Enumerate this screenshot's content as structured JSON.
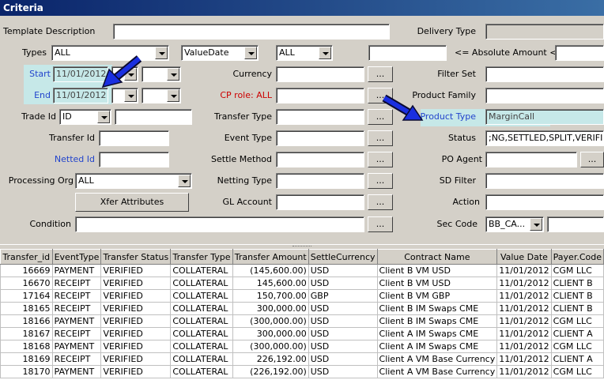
{
  "window": {
    "title": "Criteria"
  },
  "labels": {
    "template_description": "Template Description",
    "delivery_type": "Delivery Type",
    "types": "Types",
    "abs_amount": "<= Absolute Amount <=",
    "start": "Start",
    "end": "End",
    "currency": "Currency",
    "filter_set": "Filter Set",
    "cp_role": "CP role: ALL",
    "product_family": "Product Family",
    "trade_id": "Trade Id",
    "transfer_type": "Transfer Type",
    "product_type": "Product Type",
    "transfer_id": "Transfer Id",
    "event_type": "Event Type",
    "status": "Status",
    "netted_id": "Netted Id",
    "settle_method": "Settle Method",
    "po_agent": "PO Agent",
    "processing_org": "Processing Org",
    "netting_type": "Netting Type",
    "sd_filter": "SD Filter",
    "gl_account": "GL Account",
    "action": "Action",
    "condition": "Condition",
    "sec_code": "Sec Code"
  },
  "values": {
    "types": "ALL",
    "value_date": "ValueDate",
    "all2": "ALL",
    "start_date": "11/01/2012",
    "end_date": "11/01/2012",
    "trade_id": "ID",
    "processing_org": "ALL",
    "product_type": "MarginCall",
    "status": ";NG,SETTLED,SPLIT,VERIFIED",
    "sec_code": "BB_CA..."
  },
  "buttons": {
    "ellipsis": "...",
    "xfer_attributes": "Xfer Attributes"
  },
  "table": {
    "columns": [
      "Transfer_id",
      "EventType",
      "Transfer Status",
      "Transfer Type",
      "Transfer Amount",
      "SettleCurrency",
      "Contract Name",
      "Value Date",
      "Payer.Code"
    ],
    "rows": [
      [
        "16669",
        "PAYMENT",
        "VERIFIED",
        "COLLATERAL",
        "(145,600.00)",
        "USD",
        "Client B VM USD",
        "11/01/2012",
        "CGM LLC"
      ],
      [
        "16670",
        "RECEIPT",
        "VERIFIED",
        "COLLATERAL",
        "145,600.00",
        "USD",
        "Client B VM USD",
        "11/01/2012",
        "CLIENT B"
      ],
      [
        "17164",
        "RECEIPT",
        "VERIFIED",
        "COLLATERAL",
        "150,700.00",
        "GBP",
        "Client B VM GBP",
        "11/01/2012",
        "CLIENT B"
      ],
      [
        "18165",
        "RECEIPT",
        "VERIFIED",
        "COLLATERAL",
        "300,000.00",
        "USD",
        "Client B IM Swaps CME",
        "11/01/2012",
        "CLIENT B"
      ],
      [
        "18166",
        "PAYMENT",
        "VERIFIED",
        "COLLATERAL",
        "(300,000.00)",
        "USD",
        "Client B IM Swaps CME",
        "11/01/2012",
        "CGM LLC"
      ],
      [
        "18167",
        "RECEIPT",
        "VERIFIED",
        "COLLATERAL",
        "300,000.00",
        "USD",
        "Client A IM Swaps CME",
        "11/01/2012",
        "CLIENT A"
      ],
      [
        "18168",
        "PAYMENT",
        "VERIFIED",
        "COLLATERAL",
        "(300,000.00)",
        "USD",
        "Client A IM Swaps CME",
        "11/01/2012",
        "CGM LLC"
      ],
      [
        "18169",
        "RECEIPT",
        "VERIFIED",
        "COLLATERAL",
        "226,192.00",
        "USD",
        "Client A VM Base Currency",
        "11/01/2012",
        "CLIENT A"
      ],
      [
        "18170",
        "PAYMENT",
        "VERIFIED",
        "COLLATERAL",
        "(226,192.00)",
        "USD",
        "Client A VM Base Currency",
        "11/01/2012",
        "CGM LLC"
      ]
    ]
  },
  "colors": {
    "highlight": "#c6e8e8",
    "label_blue": "#2244cc",
    "label_red": "#cc0000",
    "arrow": "#1a2fe0"
  }
}
